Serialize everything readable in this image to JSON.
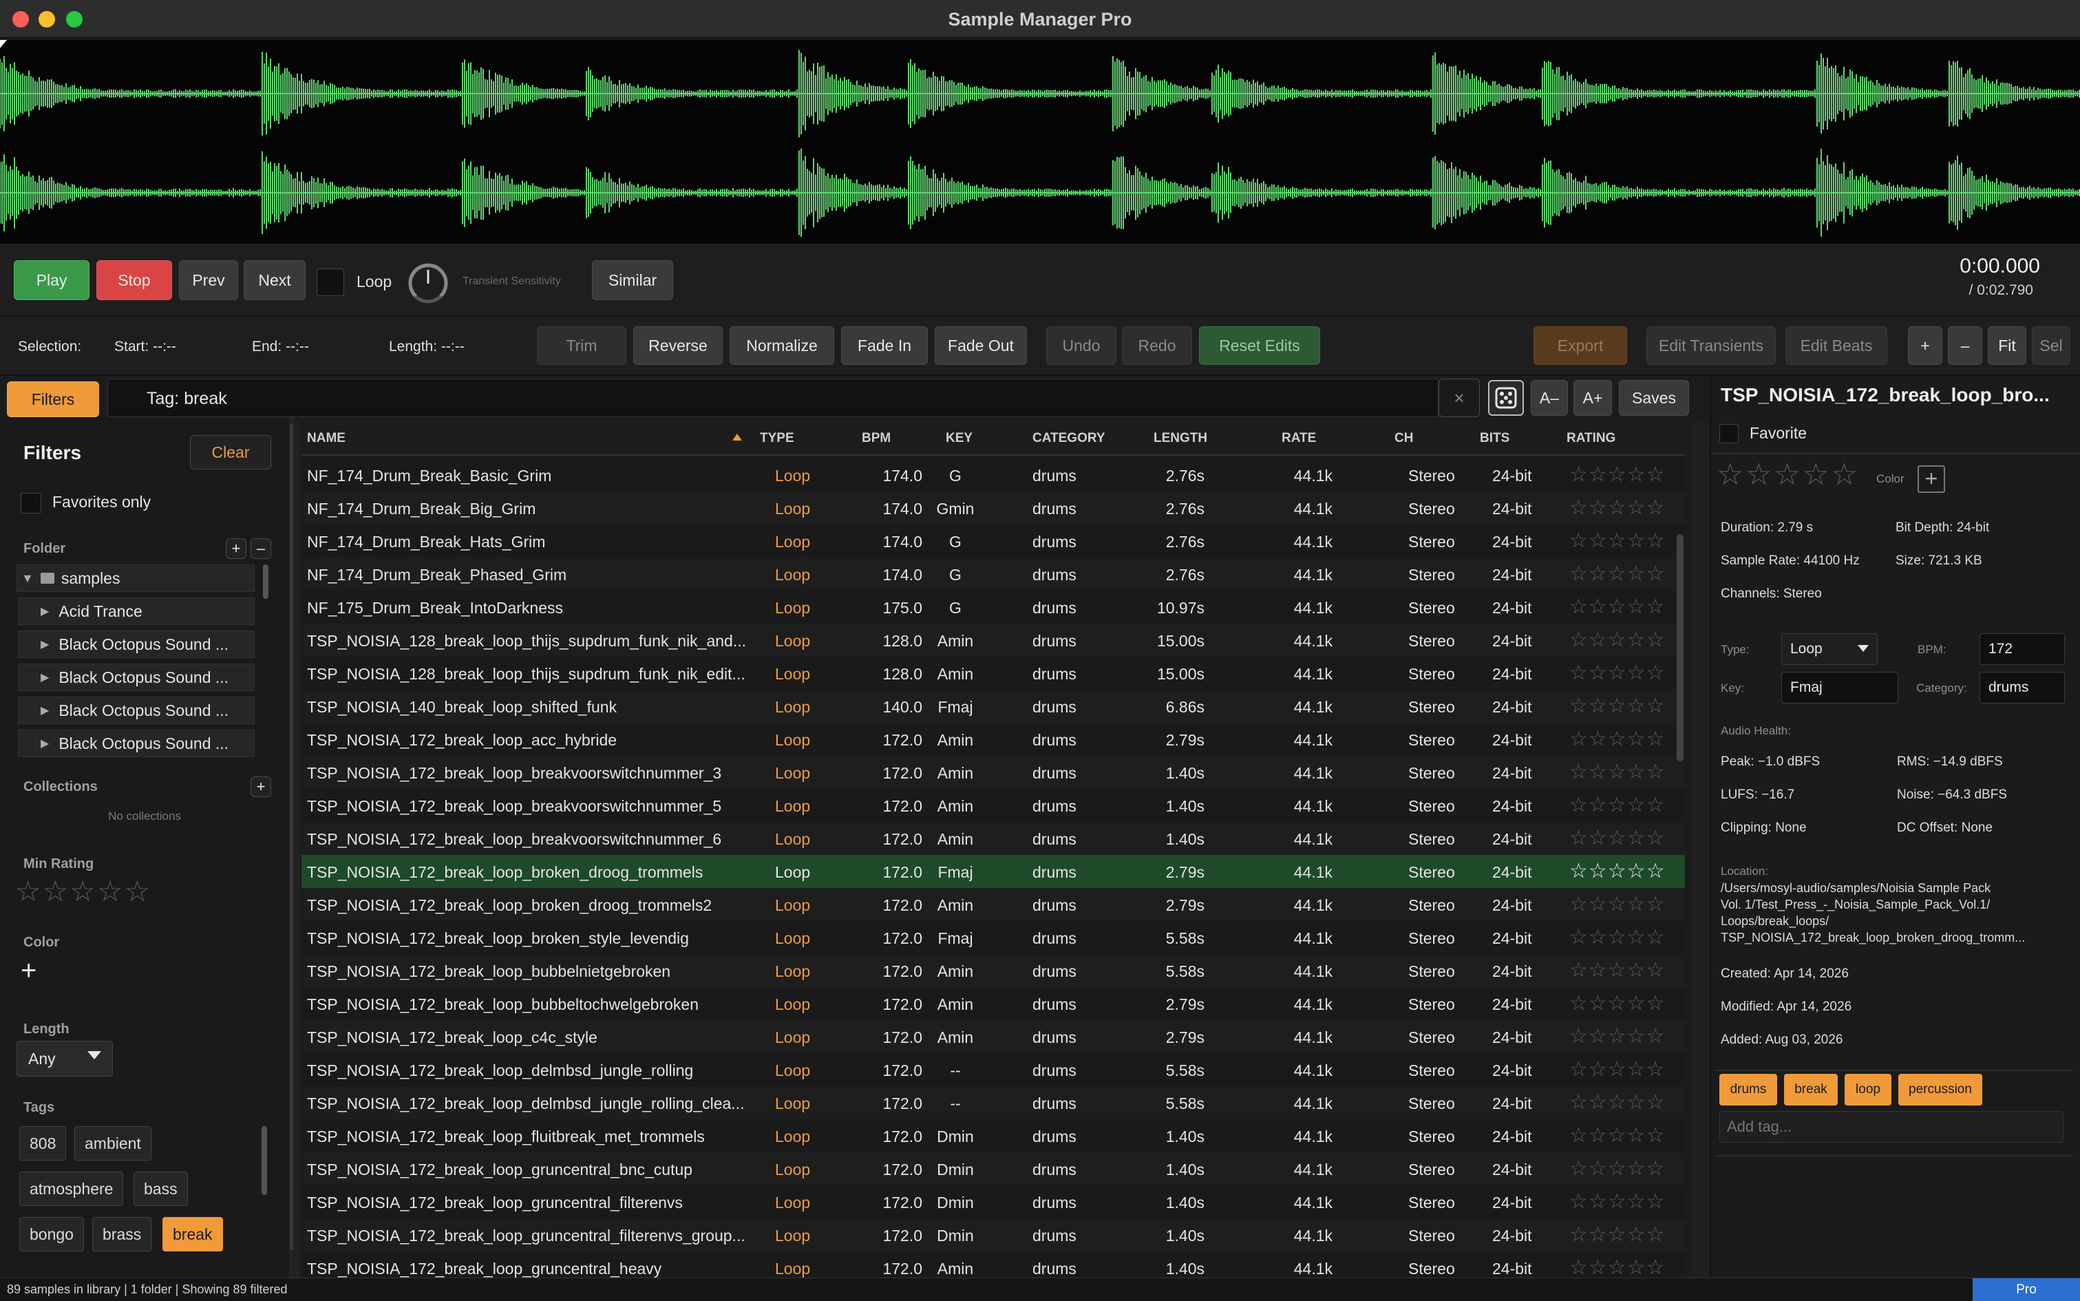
{
  "window": {
    "title": "Sample Manager Pro"
  },
  "transport": {
    "play": "Play",
    "stop": "Stop",
    "prev": "Prev",
    "next": "Next",
    "loop": "Loop",
    "transient": "Transient Sensitivity",
    "similar": "Similar",
    "time": "0:00.000",
    "duration": "/ 0:02.790"
  },
  "selection": {
    "label": "Selection:",
    "start": "Start: --:--",
    "end": "End: --:--",
    "length": "Length: --:--"
  },
  "edits": {
    "trim": "Trim",
    "reverse": "Reverse",
    "normalize": "Normalize",
    "fade_in": "Fade In",
    "fade_out": "Fade Out",
    "undo": "Undo",
    "redo": "Redo",
    "reset": "Reset Edits",
    "export": "Export",
    "edit_transients": "Edit Transients",
    "edit_beats": "Edit Beats",
    "plus": "+",
    "minus": "–",
    "fit": "Fit",
    "sel": "Sel"
  },
  "search": {
    "filters_btn": "Filters",
    "value": "Tag: break",
    "clear_x": "×",
    "a_minus": "A–",
    "a_plus": "A+",
    "saves": "Saves"
  },
  "sidebar": {
    "title": "Filters",
    "clear": "Clear",
    "favorites_only": "Favorites only",
    "folder_title": "Folder",
    "folders": [
      "samples",
      "Acid Trance",
      "Black Octopus Sound ...",
      "Black Octopus Sound ...",
      "Black Octopus Sound ...",
      "Black Octopus Sound ..."
    ],
    "collections_title": "Collections",
    "no_collections": "No collections",
    "min_rating_title": "Min Rating",
    "color_title": "Color",
    "length_title": "Length",
    "length_value": "Any",
    "tags_title": "Tags",
    "tags": [
      "808",
      "ambient",
      "atmosphere",
      "bass",
      "bongo",
      "brass",
      "break"
    ]
  },
  "table": {
    "headers": [
      "NAME",
      "TYPE",
      "BPM",
      "KEY",
      "CATEGORY",
      "LENGTH",
      "RATE",
      "CH",
      "BITS",
      "RATING"
    ],
    "rows": [
      [
        "NF_174_Drum_Break_Basic_Grim",
        "Loop",
        "174.0",
        "G",
        "drums",
        "2.76s",
        "44.1k",
        "Stereo",
        "24-bit",
        "☆☆☆☆☆"
      ],
      [
        "NF_174_Drum_Break_Big_Grim",
        "Loop",
        "174.0",
        "Gmin",
        "drums",
        "2.76s",
        "44.1k",
        "Stereo",
        "24-bit",
        "☆☆☆☆☆"
      ],
      [
        "NF_174_Drum_Break_Hats_Grim",
        "Loop",
        "174.0",
        "G",
        "drums",
        "2.76s",
        "44.1k",
        "Stereo",
        "24-bit",
        "☆☆☆☆☆"
      ],
      [
        "NF_174_Drum_Break_Phased_Grim",
        "Loop",
        "174.0",
        "G",
        "drums",
        "2.76s",
        "44.1k",
        "Stereo",
        "24-bit",
        "☆☆☆☆☆"
      ],
      [
        "NF_175_Drum_Break_IntoDarkness",
        "Loop",
        "175.0",
        "G",
        "drums",
        "10.97s",
        "44.1k",
        "Stereo",
        "24-bit",
        "☆☆☆☆☆"
      ],
      [
        "TSP_NOISIA_128_break_loop_thijs_supdrum_funk_nik_and...",
        "Loop",
        "128.0",
        "Amin",
        "drums",
        "15.00s",
        "44.1k",
        "Stereo",
        "24-bit",
        "☆☆☆☆☆"
      ],
      [
        "TSP_NOISIA_128_break_loop_thijs_supdrum_funk_nik_edit...",
        "Loop",
        "128.0",
        "Amin",
        "drums",
        "15.00s",
        "44.1k",
        "Stereo",
        "24-bit",
        "☆☆☆☆☆"
      ],
      [
        "TSP_NOISIA_140_break_loop_shifted_funk",
        "Loop",
        "140.0",
        "Fmaj",
        "drums",
        "6.86s",
        "44.1k",
        "Stereo",
        "24-bit",
        "☆☆☆☆☆"
      ],
      [
        "TSP_NOISIA_172_break_loop_acc_hybride",
        "Loop",
        "172.0",
        "Amin",
        "drums",
        "2.79s",
        "44.1k",
        "Stereo",
        "24-bit",
        "☆☆☆☆☆"
      ],
      [
        "TSP_NOISIA_172_break_loop_breakvoorswitchnummer_3",
        "Loop",
        "172.0",
        "Amin",
        "drums",
        "1.40s",
        "44.1k",
        "Stereo",
        "24-bit",
        "☆☆☆☆☆"
      ],
      [
        "TSP_NOISIA_172_break_loop_breakvoorswitchnummer_5",
        "Loop",
        "172.0",
        "Amin",
        "drums",
        "1.40s",
        "44.1k",
        "Stereo",
        "24-bit",
        "☆☆☆☆☆"
      ],
      [
        "TSP_NOISIA_172_break_loop_breakvoorswitchnummer_6",
        "Loop",
        "172.0",
        "Amin",
        "drums",
        "1.40s",
        "44.1k",
        "Stereo",
        "24-bit",
        "☆☆☆☆☆"
      ],
      [
        "TSP_NOISIA_172_break_loop_broken_droog_trommels",
        "Loop",
        "172.0",
        "Fmaj",
        "drums",
        "2.79s",
        "44.1k",
        "Stereo",
        "24-bit",
        "☆☆☆☆☆"
      ],
      [
        "TSP_NOISIA_172_break_loop_broken_droog_trommels2",
        "Loop",
        "172.0",
        "Amin",
        "drums",
        "2.79s",
        "44.1k",
        "Stereo",
        "24-bit",
        "☆☆☆☆☆"
      ],
      [
        "TSP_NOISIA_172_break_loop_broken_style_levendig",
        "Loop",
        "172.0",
        "Fmaj",
        "drums",
        "5.58s",
        "44.1k",
        "Stereo",
        "24-bit",
        "☆☆☆☆☆"
      ],
      [
        "TSP_NOISIA_172_break_loop_bubbelnietgebroken",
        "Loop",
        "172.0",
        "Amin",
        "drums",
        "5.58s",
        "44.1k",
        "Stereo",
        "24-bit",
        "☆☆☆☆☆"
      ],
      [
        "TSP_NOISIA_172_break_loop_bubbeltochwelgebroken",
        "Loop",
        "172.0",
        "Amin",
        "drums",
        "2.79s",
        "44.1k",
        "Stereo",
        "24-bit",
        "☆☆☆☆☆"
      ],
      [
        "TSP_NOISIA_172_break_loop_c4c_style",
        "Loop",
        "172.0",
        "Amin",
        "drums",
        "2.79s",
        "44.1k",
        "Stereo",
        "24-bit",
        "☆☆☆☆☆"
      ],
      [
        "TSP_NOISIA_172_break_loop_delmbsd_jungle_rolling",
        "Loop",
        "172.0",
        "--",
        "drums",
        "5.58s",
        "44.1k",
        "Stereo",
        "24-bit",
        "☆☆☆☆☆"
      ],
      [
        "TSP_NOISIA_172_break_loop_delmbsd_jungle_rolling_clea...",
        "Loop",
        "172.0",
        "--",
        "drums",
        "5.58s",
        "44.1k",
        "Stereo",
        "24-bit",
        "☆☆☆☆☆"
      ],
      [
        "TSP_NOISIA_172_break_loop_fluitbreak_met_trommels",
        "Loop",
        "172.0",
        "Dmin",
        "drums",
        "1.40s",
        "44.1k",
        "Stereo",
        "24-bit",
        "☆☆☆☆☆"
      ],
      [
        "TSP_NOISIA_172_break_loop_gruncentral_bnc_cutup",
        "Loop",
        "172.0",
        "Dmin",
        "drums",
        "1.40s",
        "44.1k",
        "Stereo",
        "24-bit",
        "☆☆☆☆☆"
      ],
      [
        "TSP_NOISIA_172_break_loop_gruncentral_filterenvs",
        "Loop",
        "172.0",
        "Dmin",
        "drums",
        "1.40s",
        "44.1k",
        "Stereo",
        "24-bit",
        "☆☆☆☆☆"
      ],
      [
        "TSP_NOISIA_172_break_loop_gruncentral_filterenvs_group...",
        "Loop",
        "172.0",
        "Dmin",
        "drums",
        "1.40s",
        "44.1k",
        "Stereo",
        "24-bit",
        "☆☆☆☆☆"
      ],
      [
        "TSP_NOISIA_172_break_loop_gruncentral_heavy",
        "Loop",
        "172.0",
        "Amin",
        "drums",
        "1.40s",
        "44.1k",
        "Stereo",
        "24-bit",
        "☆☆☆☆☆"
      ]
    ],
    "selected_index": 12
  },
  "detail": {
    "title": "TSP_NOISIA_172_break_loop_bro...",
    "favorite": "Favorite",
    "color_label": "Color",
    "duration": "Duration: 2.79 s",
    "bit_depth": "Bit Depth: 24-bit",
    "sample_rate": "Sample Rate: 44100 Hz",
    "size": "Size: 721.3 KB",
    "channels": "Channels: Stereo",
    "type_label": "Type:",
    "type_value": "Loop",
    "bpm_label": "BPM:",
    "bpm_value": "172",
    "key_label": "Key:",
    "key_value": "Fmaj",
    "category_label": "Category:",
    "category_value": "drums",
    "health_title": "Audio Health:",
    "peak": "Peak: −1.0 dBFS",
    "rms": "RMS: −14.9 dBFS",
    "lufs": "LUFS: −16.7",
    "noise": "Noise: −64.3 dBFS",
    "clipping": "Clipping: None",
    "dc_offset": "DC Offset: None",
    "location_title": "Location:",
    "location_lines": [
      "/Users/mosyl-audio/samples/Noisia Sample Pack",
      "Vol. 1/Test_Press_-_Noisia_Sample_Pack_Vol.1/",
      "Loops/break_loops/",
      "TSP_NOISIA_172_break_loop_broken_droog_tromm..."
    ],
    "created": "Created: Apr 14, 2026",
    "modified": "Modified: Apr 14, 2026",
    "added": "Added: Aug 03, 2026",
    "tags": [
      "drums",
      "break",
      "loop",
      "percussion"
    ],
    "add_tag_placeholder": "Add tag..."
  },
  "status": {
    "text": "89 samples in library | 1 folder | Showing 89 filtered",
    "pro": "Pro"
  },
  "colors": {
    "accent_orange": "#f09a3a",
    "play_green": "#3a9a4a",
    "stop_red": "#d94545",
    "wave_green": "#5fd46e",
    "selected_row": "#1e4a2a"
  },
  "icons": {
    "sort": "sort-asc-icon",
    "dice": "dice-icon",
    "dropdown": "chevron-down-icon",
    "folder": "folder-icon",
    "disclosure": "disclosure-triangle-icon"
  }
}
